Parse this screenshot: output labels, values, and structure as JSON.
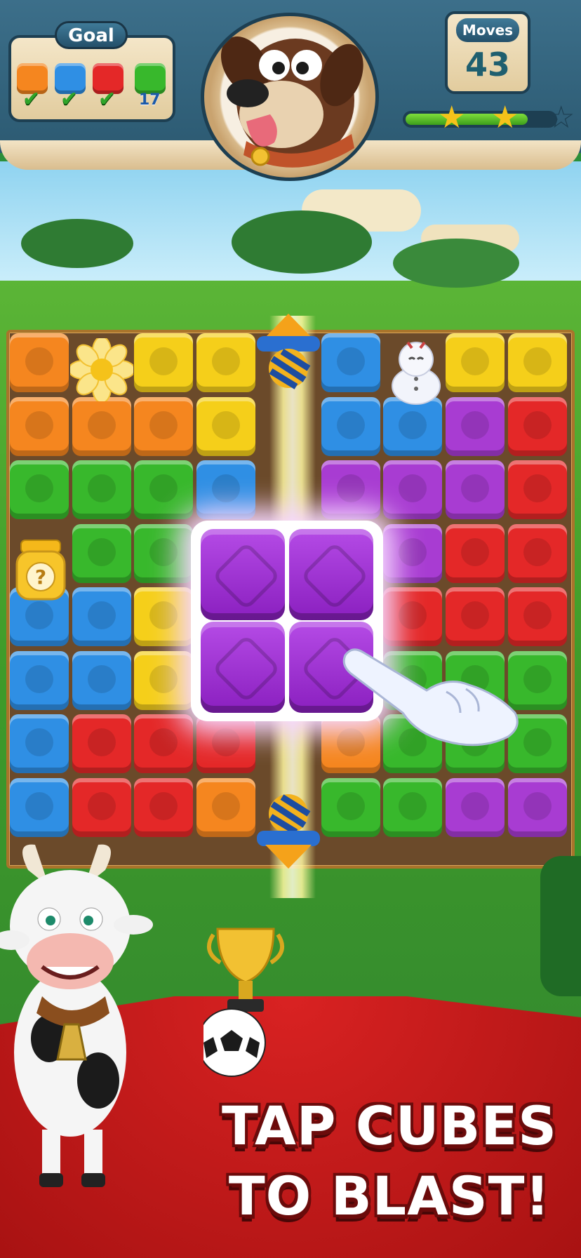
{
  "header": {
    "goal_title": "Goal",
    "goals": [
      {
        "color": "orange",
        "hex": "#f5861f",
        "status": "check"
      },
      {
        "color": "blue",
        "hex": "#2f8fe4",
        "status": "check"
      },
      {
        "color": "red",
        "hex": "#e42828",
        "status": "check"
      },
      {
        "color": "green",
        "hex": "#38b82c",
        "remaining": "17"
      }
    ],
    "check_glyph": "✔",
    "moves_label": "Moves",
    "moves_value": "43",
    "stars": {
      "earned": 2,
      "total": 3
    },
    "progress": 0.82,
    "mascot": "dog-avatar"
  },
  "board": {
    "rows": [
      [
        "orange",
        "flower",
        "yellow",
        "yellow",
        "rocket",
        "blue",
        "snowman",
        "yellow",
        "yellow"
      ],
      [
        "orange",
        "orange",
        "orange",
        "yellow",
        "beam",
        "blue",
        "blue",
        "purple",
        "red"
      ],
      [
        "green",
        "green",
        "green",
        "blue",
        "beam",
        "purple",
        "purple",
        "purple",
        "red"
      ],
      [
        "honey",
        "green",
        "green",
        "big",
        "big",
        "big",
        "purple",
        "red",
        "red"
      ],
      [
        "blue",
        "blue",
        "yellow",
        "big",
        "big",
        "big",
        "red",
        "red",
        "red"
      ],
      [
        "blue",
        "blue",
        "yellow",
        "big",
        "big",
        "big",
        "green",
        "green",
        "green"
      ],
      [
        "blue",
        "red",
        "red",
        "red",
        "beam",
        "orange",
        "green",
        "green",
        "green"
      ],
      [
        "blue",
        "red",
        "red",
        "orange",
        "rocket",
        "green",
        "green",
        "purple",
        "purple"
      ]
    ],
    "colors": {
      "orange": "#f5861f",
      "yellow": "#f5cf1a",
      "blue": "#2f8fe4",
      "red": "#e42828",
      "green": "#38b82c",
      "purple": "#a83cd2"
    },
    "special_pieces": [
      "rocket-icon",
      "flower-icon",
      "snowman-icon",
      "honey-jar-icon",
      "big-purple-cube"
    ]
  },
  "tagline": {
    "line1": "TAP CUBES",
    "line2": "TO BLAST!"
  }
}
